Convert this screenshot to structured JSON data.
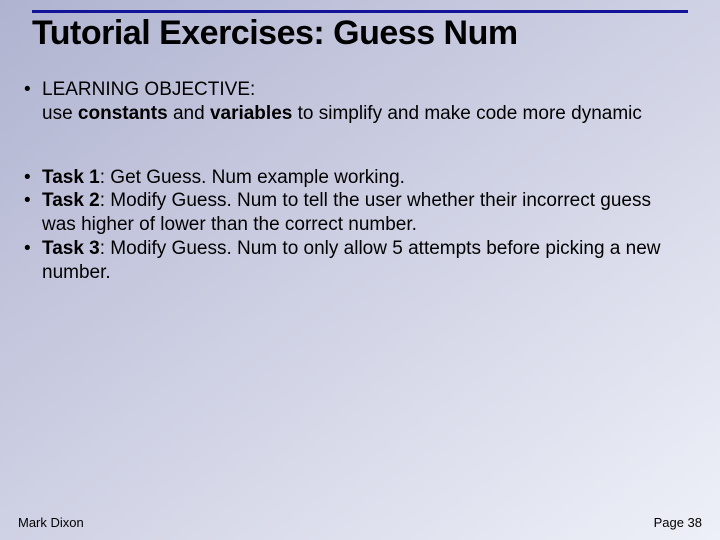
{
  "title": "Tutorial Exercises: Guess Num",
  "objective": {
    "label": "LEARNING OBJECTIVE:",
    "pre": "use ",
    "b1": "constants",
    "mid": " and ",
    "b2": "variables",
    "post": " to simplify and make code more dynamic"
  },
  "tasks": {
    "t1_label": "Task 1",
    "t1_text": ": Get Guess. Num example working.",
    "t2_label": "Task 2",
    "t2_text": ": Modify Guess. Num to tell the user whether their incorrect guess was higher of lower than the correct number.",
    "t3_label": "Task 3",
    "t3_text": ": Modify Guess. Num to only allow 5 attempts before picking a new number."
  },
  "footer": {
    "author": "Mark Dixon",
    "page": "Page 38"
  },
  "bullet": "•"
}
